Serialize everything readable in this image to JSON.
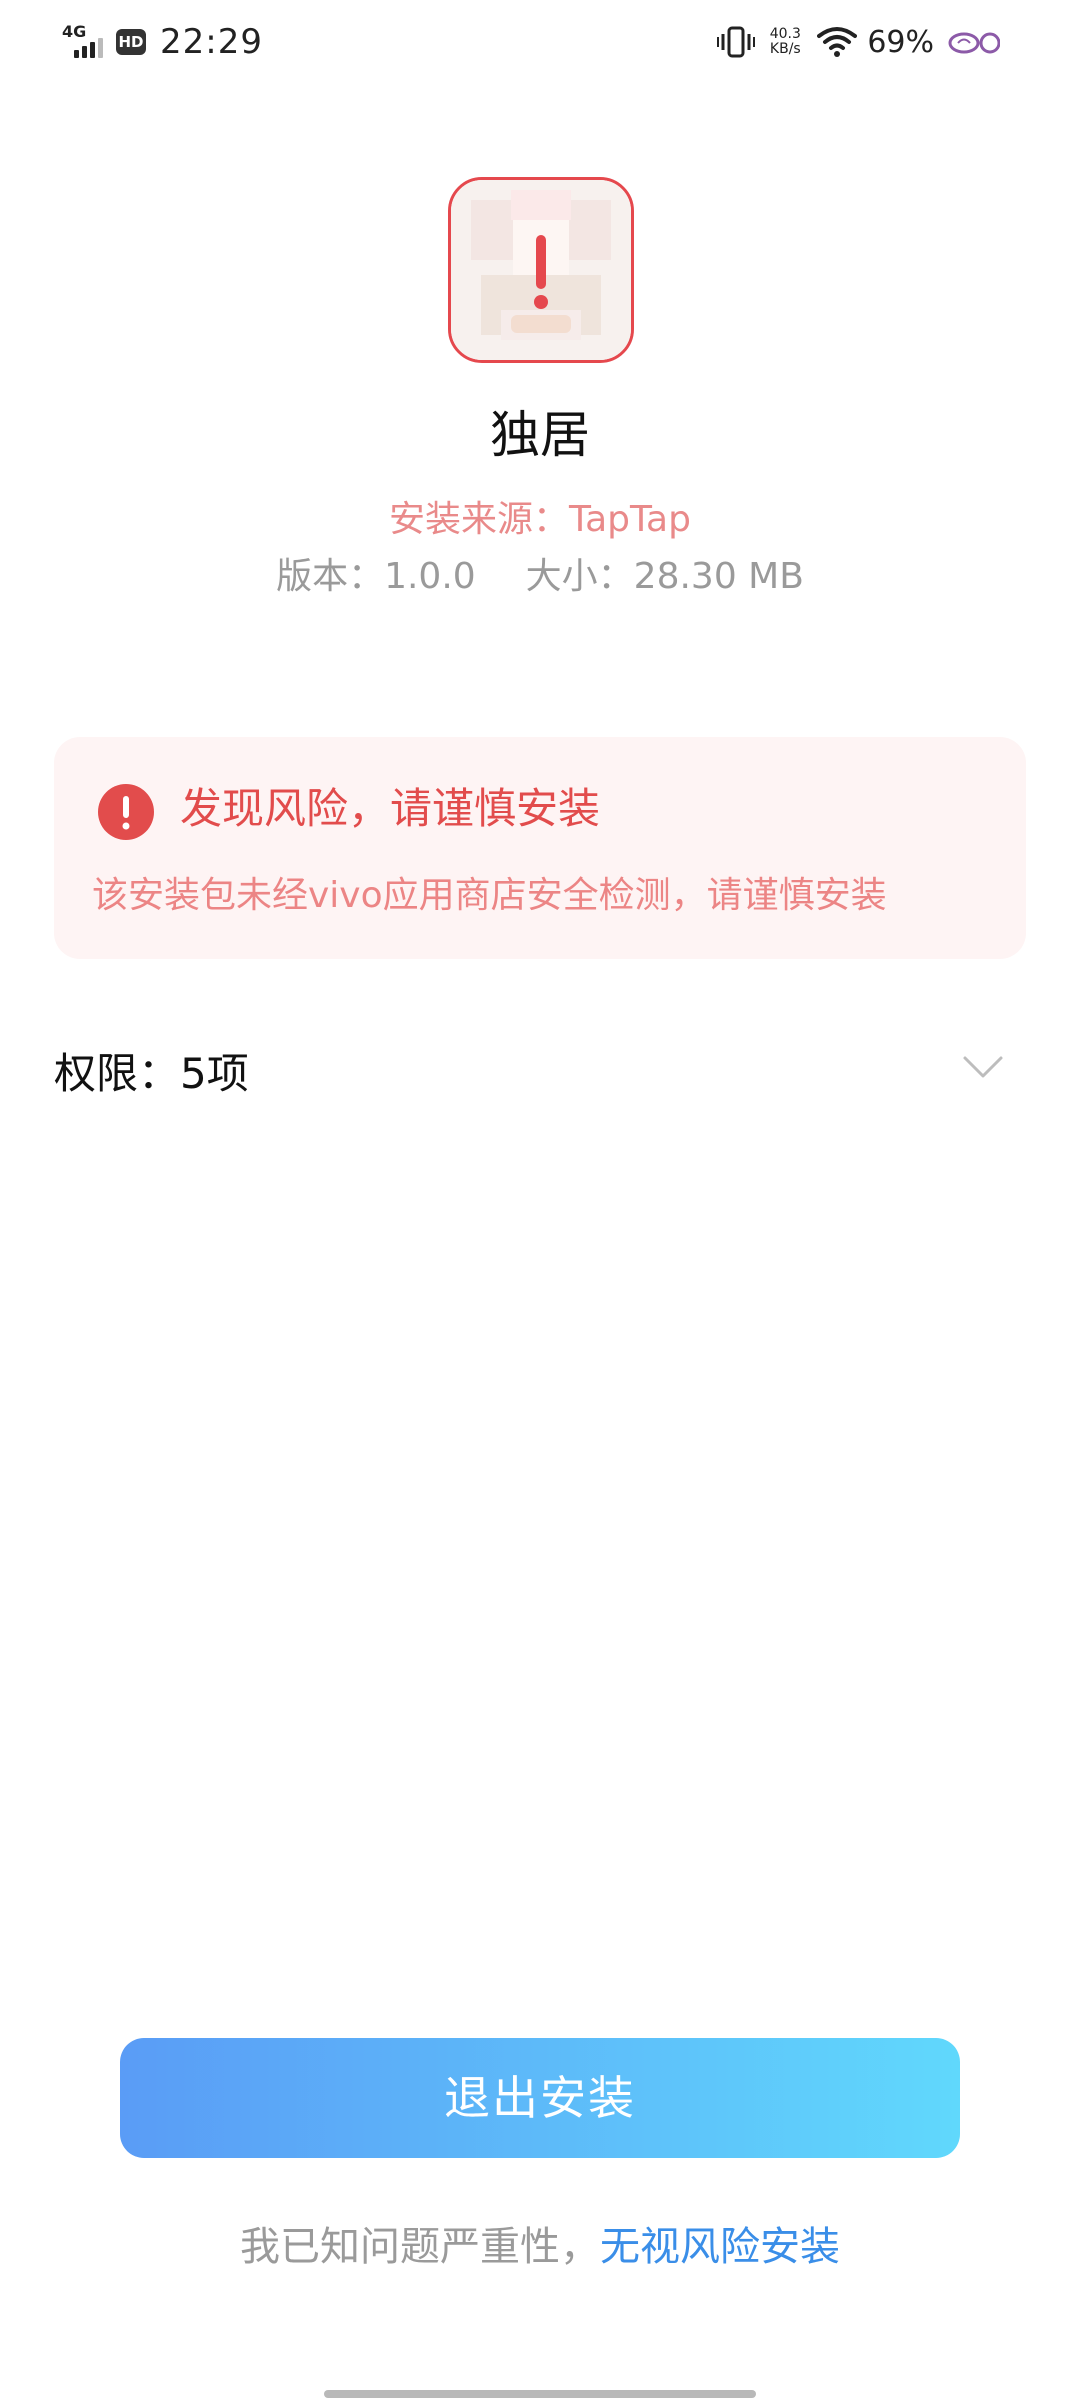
{
  "status_bar": {
    "network": "4G",
    "hd_badge": "HD",
    "time": "22:29",
    "net_speed_value": "40.3",
    "net_speed_unit": "KB/s",
    "battery": "69%"
  },
  "app": {
    "name": "独居",
    "install_source": "安装来源：TapTap",
    "version": "版本：1.0.0",
    "size": "大小：28.30 MB"
  },
  "risk_card": {
    "title": "发现风险，请谨慎安装",
    "description": "该安装包未经vivo应用商店安全检测，请谨慎安装"
  },
  "permissions": {
    "label": "权限：5项"
  },
  "actions": {
    "exit_install": "退出安装",
    "ignore_prefix": "我已知问题严重性，",
    "ignore_link": "无视风险安装"
  },
  "colors": {
    "danger": "#e24c4c",
    "link": "#3a8ee8",
    "button_gradient_start": "#5a9cf6",
    "button_gradient_end": "#60d8fc"
  },
  "icons": [
    "vibrate-icon",
    "wifi-icon",
    "signal-icon",
    "warning-icon",
    "chevron-down-icon"
  ]
}
